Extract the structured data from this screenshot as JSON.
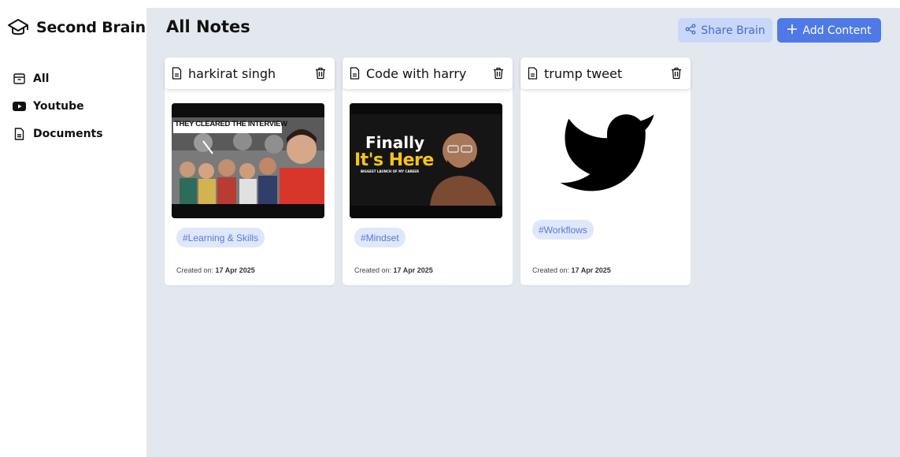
{
  "app": {
    "title": "Second Brain",
    "logo_icon": "brain-icon"
  },
  "sidebar": {
    "items": [
      {
        "label": "All",
        "icon": "inbox-icon"
      },
      {
        "label": "Youtube",
        "icon": "youtube-icon"
      },
      {
        "label": "Documents",
        "icon": "document-icon"
      }
    ]
  },
  "header": {
    "title": "All Notes",
    "share_label": "Share Brain",
    "add_label": "Add Content"
  },
  "cards": [
    {
      "title": "harkirat singh",
      "thumbnail_text": "THEY CLEARED THE INTERVIEW",
      "tag": "#Learning & Skills",
      "created_prefix": "Created on:",
      "created_date": "17 Apr 2025"
    },
    {
      "title": "Code with harry",
      "thumbnail_text": [
        "Finally",
        "It's Here",
        "BIGGEST LAUNCH OF MY CAREER"
      ],
      "tag": "#Mindset",
      "created_prefix": "Created on:",
      "created_date": "17 Apr 2025"
    },
    {
      "title": "trump tweet",
      "thumbnail_icon": "twitter-bird-icon",
      "tag": "#Workflows",
      "created_prefix": "Created on:",
      "created_date": "17 Apr 2025"
    }
  ],
  "colors": {
    "accent": "#4f7ae6",
    "accent_light": "#c9d8fa",
    "background": "#e3e8ef",
    "tag_bg": "#dfe7fb",
    "tag_text": "#5b78d6",
    "thumb_yellow": "#f5c518"
  }
}
